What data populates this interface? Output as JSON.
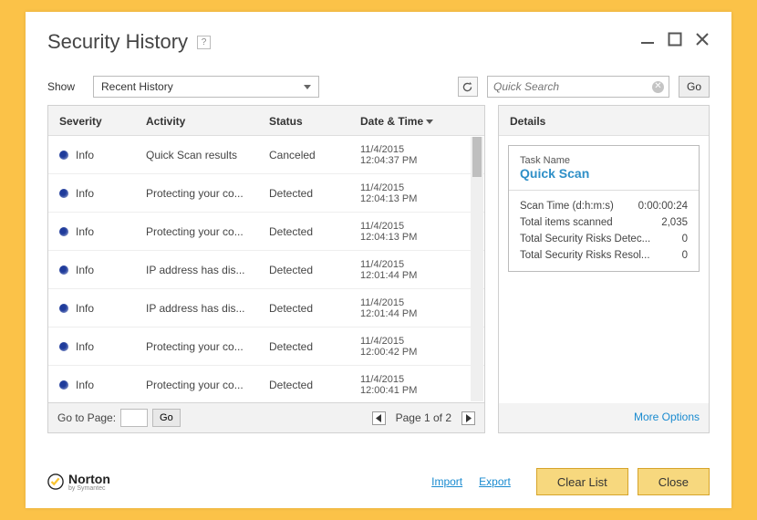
{
  "window": {
    "title": "Security History"
  },
  "controls": {
    "show_label": "Show",
    "dropdown_value": "Recent History",
    "search_placeholder": "Quick Search",
    "go_label": "Go"
  },
  "table": {
    "headers": {
      "severity": "Severity",
      "activity": "Activity",
      "status": "Status",
      "datetime": "Date & Time"
    },
    "rows": [
      {
        "severity": "Info",
        "activity": "Quick Scan results",
        "status": "Canceled",
        "date": "11/4/2015",
        "time": "12:04:37 PM"
      },
      {
        "severity": "Info",
        "activity": "Protecting your co...",
        "status": "Detected",
        "date": "11/4/2015",
        "time": "12:04:13 PM"
      },
      {
        "severity": "Info",
        "activity": "Protecting your co...",
        "status": "Detected",
        "date": "11/4/2015",
        "time": "12:04:13 PM"
      },
      {
        "severity": "Info",
        "activity": "IP address has dis...",
        "status": "Detected",
        "date": "11/4/2015",
        "time": "12:01:44 PM"
      },
      {
        "severity": "Info",
        "activity": "IP address has dis...",
        "status": "Detected",
        "date": "11/4/2015",
        "time": "12:01:44 PM"
      },
      {
        "severity": "Info",
        "activity": "Protecting your co...",
        "status": "Detected",
        "date": "11/4/2015",
        "time": "12:00:42 PM"
      },
      {
        "severity": "Info",
        "activity": "Protecting your co...",
        "status": "Detected",
        "date": "11/4/2015",
        "time": "12:00:41 PM"
      }
    ],
    "pager": {
      "goto_label": "Go to Page:",
      "go_label": "Go",
      "page_text": "Page 1 of 2"
    }
  },
  "details": {
    "header": "Details",
    "task_label": "Task Name",
    "task_name": "Quick Scan",
    "stats": [
      {
        "label": "Scan Time (d:h:m:s)",
        "value": "0:00:00:24"
      },
      {
        "label": "Total items scanned",
        "value": "2,035"
      },
      {
        "label": "Total Security Risks Detec...",
        "value": "0"
      },
      {
        "label": "Total Security Risks Resol...",
        "value": "0"
      }
    ],
    "more_options": "More Options"
  },
  "footer": {
    "brand": "Norton",
    "brand_sub": "by Symantec",
    "import": "Import",
    "export": "Export",
    "clear_list": "Clear List",
    "close": "Close"
  }
}
